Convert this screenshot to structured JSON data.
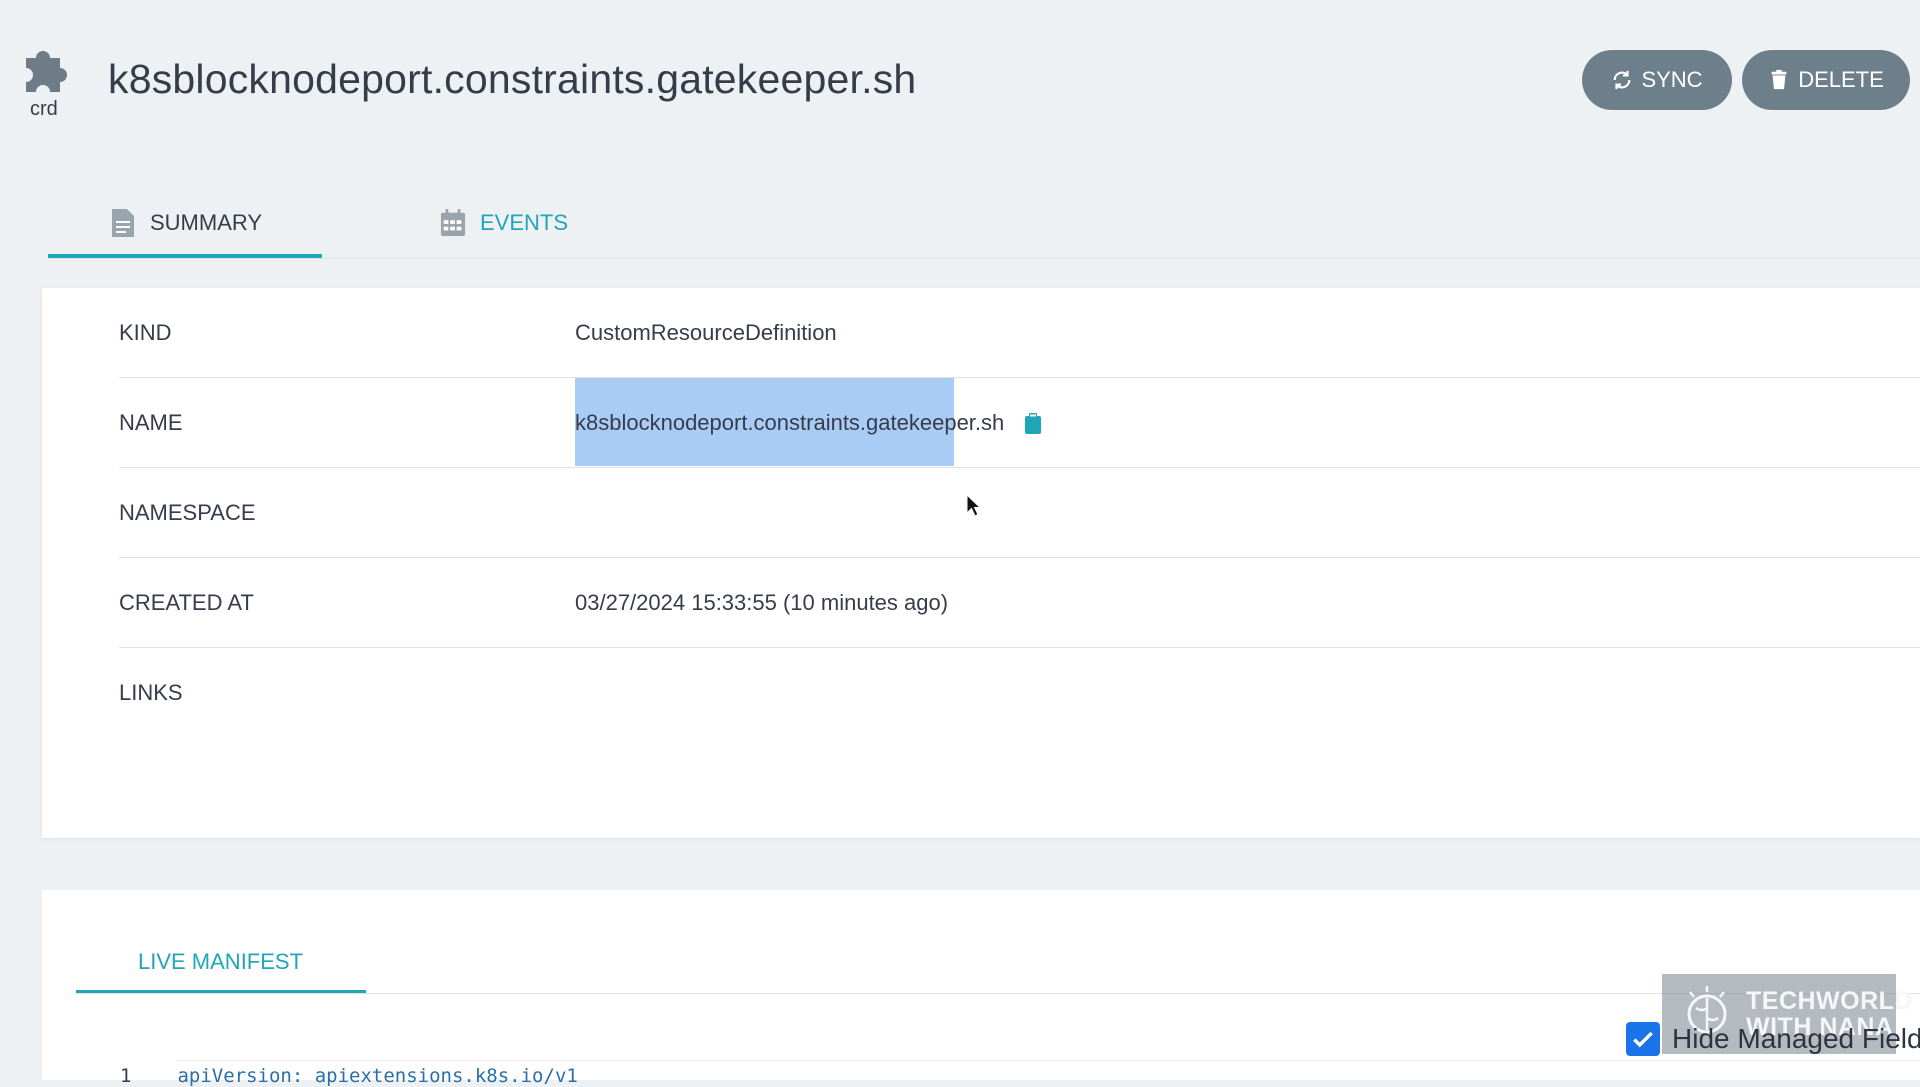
{
  "header": {
    "resource_type": "crd",
    "title": "k8sblocknodeport.constraints.gatekeeper.sh",
    "sync_label": "SYNC",
    "delete_label": "DELETE"
  },
  "tabs": [
    {
      "label": "SUMMARY",
      "icon": "document-icon",
      "active": true
    },
    {
      "label": "EVENTS",
      "icon": "calendar-icon",
      "active": false
    }
  ],
  "summary": {
    "rows": [
      {
        "key": "KIND",
        "value": "CustomResourceDefinition"
      },
      {
        "key": "NAME",
        "value": "k8sblocknodeport.constraints.gatekeeper.sh"
      },
      {
        "key": "NAMESPACE",
        "value": ""
      },
      {
        "key": "CREATED AT",
        "value": "03/27/2024 15:33:55  (10 minutes ago)"
      },
      {
        "key": "LINKS",
        "value": ""
      }
    ]
  },
  "manifest": {
    "tab_label": "LIVE MANIFEST",
    "hide_managed_label": "Hide Managed Field",
    "hide_managed_checked": true,
    "code": {
      "line_number": "1",
      "text": "apiVersion: apiextensions.k8s.io/v1"
    }
  },
  "watermark": {
    "text": "TECHWORLD\nWITH NANA"
  },
  "colors": {
    "accent": "#21a6b8",
    "button": "#6d7f8b",
    "selection": "#a9ccf6",
    "checkbox": "#1a73e8"
  }
}
